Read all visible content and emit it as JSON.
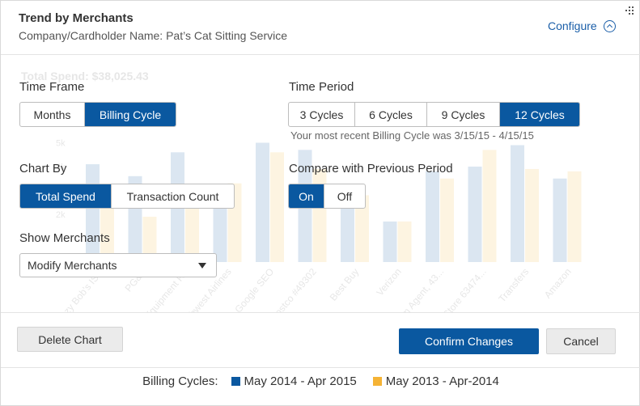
{
  "header": {
    "title": "Trend by Merchants",
    "subtitle": "Company/Cardholder Name: Pat’s Cat Sitting Service",
    "configure_label": "Configure",
    "configure_icon": "chevron-up-circle-icon",
    "grip_icon": "drag-grip-icon"
  },
  "background_chart": {
    "total_spend": "Total Spend: $38,025.43",
    "y_ticks": [
      "5k",
      "4k",
      "3k",
      "2k"
    ],
    "merchants": [
      "Crazy Bob's ISM",
      "PG&E",
      "Equipment RA",
      "Southwest Airlines",
      "Google SEO",
      "Costco #49302",
      "Best Buy",
      "Verizon",
      "State Farm Agent, 43...",
      "Home Store 63474...",
      "Transfers",
      "Amazon"
    ],
    "current": [
      4.1,
      3.6,
      4.6,
      2.9,
      5.0,
      4.7,
      3.0,
      1.7,
      3.8,
      4.0,
      4.9,
      3.5
    ],
    "previous": [
      2.3,
      1.9,
      2.5,
      3.3,
      4.6,
      3.9,
      2.8,
      1.7,
      3.5,
      4.7,
      3.9,
      3.8
    ],
    "ylim": [
      0,
      6
    ]
  },
  "controls": {
    "time_frame": {
      "label": "Time Frame",
      "options": [
        "Months",
        "Billing Cycle"
      ],
      "selected": "Billing Cycle"
    },
    "time_period": {
      "label": "Time Period",
      "options": [
        "3 Cycles",
        "6 Cycles",
        "9 Cycles",
        "12 Cycles"
      ],
      "selected": "12 Cycles",
      "hint": "Your most recent Billing Cycle was 3/15/15 - 4/15/15"
    },
    "chart_by": {
      "label": "Chart By",
      "options": [
        "Total Spend",
        "Transaction Count"
      ],
      "selected": "Total Spend"
    },
    "compare": {
      "label": "Compare with Previous Period",
      "options": [
        "On",
        "Off"
      ],
      "selected": "On"
    },
    "show_merchants": {
      "label": "Show Merchants",
      "value": "Modify Merchants",
      "caret_icon": "caret-down-icon"
    }
  },
  "actions": {
    "delete_label": "Delete Chart",
    "confirm_label": "Confirm Changes",
    "cancel_label": "Cancel"
  },
  "legend": {
    "label": "Billing Cycles:",
    "items": [
      {
        "name": "May 2014 - Apr 2015",
        "color": "#0a58a0"
      },
      {
        "name": "May 2013 - Apr-2014",
        "color": "#f5b335"
      }
    ]
  },
  "colors": {
    "accent": "#0a58a0",
    "link": "#1a5ea8",
    "previous_series": "#f5b335"
  }
}
